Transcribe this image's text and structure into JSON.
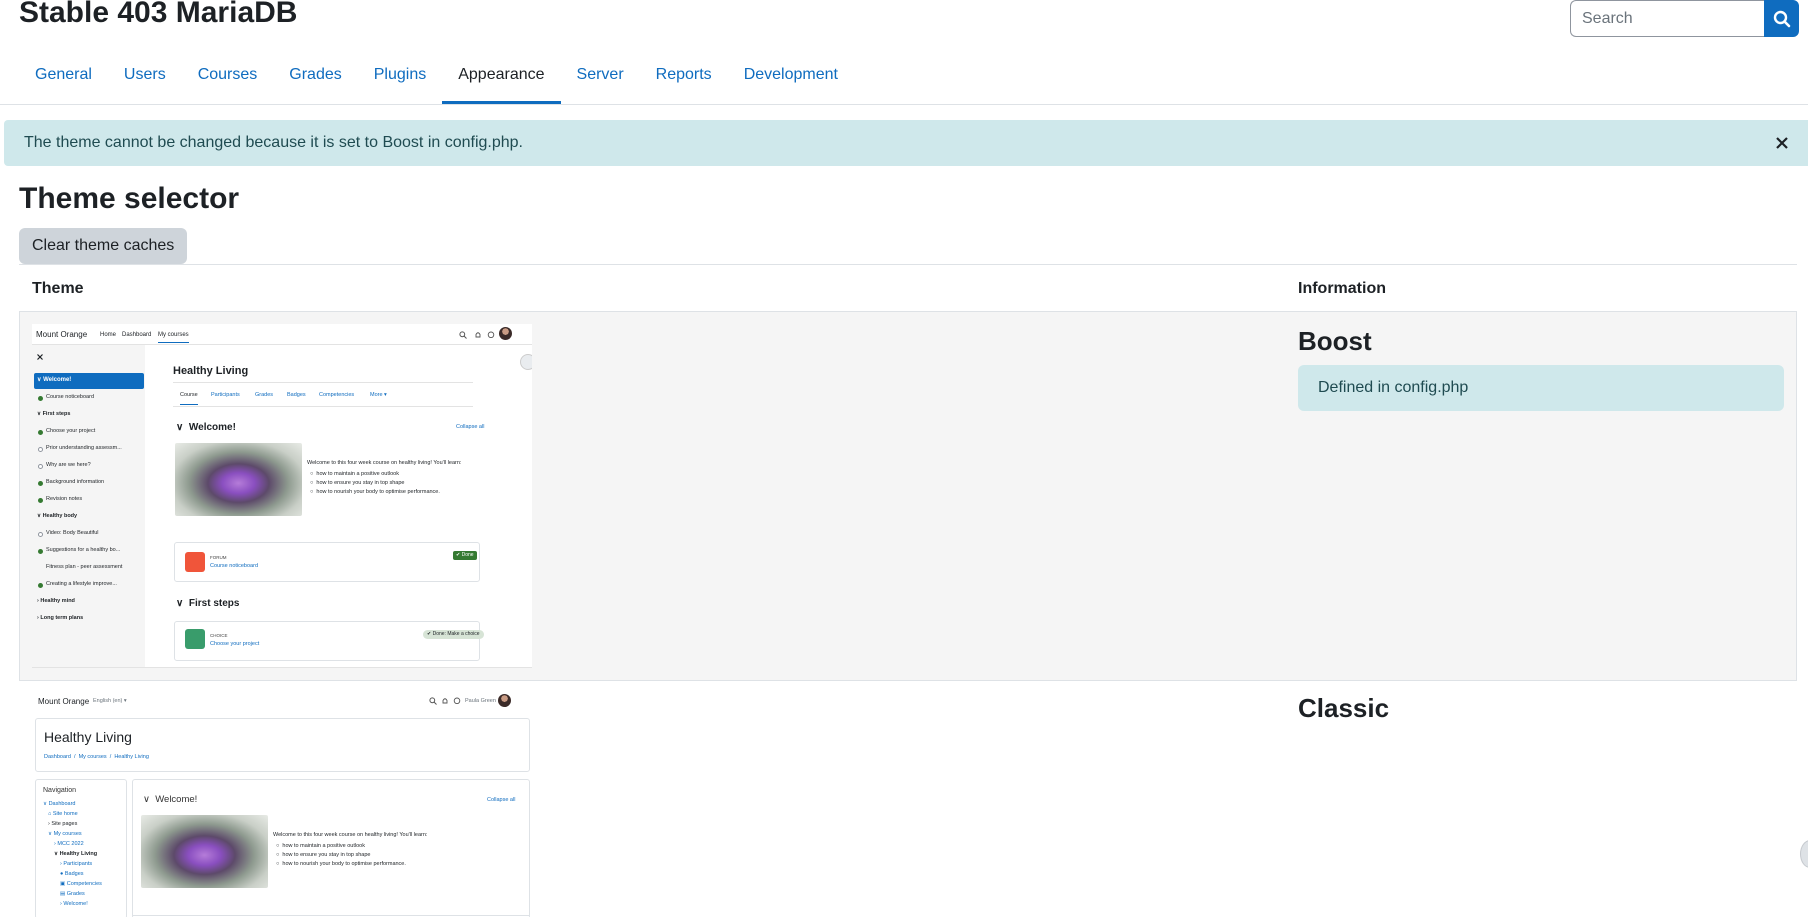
{
  "header": {
    "site_title": "Stable 403 MariaDB",
    "search_placeholder": "Search"
  },
  "tabs": [
    {
      "label": "General",
      "active": false
    },
    {
      "label": "Users",
      "active": false
    },
    {
      "label": "Courses",
      "active": false
    },
    {
      "label": "Grades",
      "active": false
    },
    {
      "label": "Plugins",
      "active": false
    },
    {
      "label": "Appearance",
      "active": true
    },
    {
      "label": "Server",
      "active": false
    },
    {
      "label": "Reports",
      "active": false
    },
    {
      "label": "Development",
      "active": false
    }
  ],
  "alert": {
    "message": "The theme cannot be changed because it is set to Boost in config.php."
  },
  "page": {
    "heading": "Theme selector",
    "clear_button": "Clear theme caches"
  },
  "table": {
    "col_theme": "Theme",
    "col_info": "Information",
    "rows": [
      {
        "name": "Boost",
        "defined": "Defined in config.php"
      },
      {
        "name": "Classic"
      }
    ]
  },
  "boost_preview": {
    "brand": "Mount Orange",
    "nav": [
      "Home",
      "Dashboard",
      "My courses"
    ],
    "drawer": [
      {
        "label": "Welcome!",
        "type": "section-active"
      },
      {
        "label": "Course noticeboard",
        "type": "done"
      },
      {
        "label": "First steps",
        "type": "section"
      },
      {
        "label": "Choose your project",
        "type": "done"
      },
      {
        "label": "Prior understanding assessm...",
        "type": "todo"
      },
      {
        "label": "Why are we here?",
        "type": "todo"
      },
      {
        "label": "Background information",
        "type": "done"
      },
      {
        "label": "Revision notes",
        "type": "done"
      },
      {
        "label": "Healthy body",
        "type": "section"
      },
      {
        "label": "Video: Body Beautiful",
        "type": "todo"
      },
      {
        "label": "Suggestions for a healthy bo...",
        "type": "done"
      },
      {
        "label": "Fitness plan - peer assessment",
        "type": "plain"
      },
      {
        "label": "Creating a lifestyle improve...",
        "type": "done"
      },
      {
        "label": "Healthy mind",
        "type": "section-collapsed"
      },
      {
        "label": "Long term plans",
        "type": "section-collapsed"
      }
    ],
    "course_title": "Healthy Living",
    "course_tabs": [
      "Course",
      "Participants",
      "Grades",
      "Badges",
      "Competencies",
      "More"
    ],
    "section_welcome": "Welcome!",
    "collapse_all": "Collapse all",
    "intro": "Welcome to this four week course on healthy living! You'll learn:",
    "bullets": [
      "how to maintain a positive outlook",
      "how to ensure you stay in top shape",
      "how to nourish your body to optimise performance."
    ],
    "forum_type": "FORUM",
    "forum_name": "Course noticeboard",
    "done_badge": "Done",
    "section_first": "First steps",
    "choice_type": "CHOICE",
    "choice_name": "Choose your project",
    "choice_badge": "Done: Make a choice"
  },
  "classic_preview": {
    "brand": "Mount Orange",
    "lang": "English (en)",
    "user": "Paula Green",
    "course_title": "Healthy Living",
    "breadcrumb": [
      "Dashboard",
      "My courses",
      "Healthy Living"
    ],
    "nav_title": "Navigation",
    "nav_items": [
      "Dashboard",
      "Site home",
      "Site pages",
      "My courses",
      "MCC 2022",
      "Healthy Living",
      "Participants",
      "Badges",
      "Competencies",
      "Grades",
      "Welcome!"
    ],
    "section_welcome": "Welcome!",
    "collapse_all": "Collapse all",
    "intro": "Welcome to this four week course on healthy living! You'll learn:",
    "bullets": [
      "how to maintain a positive outlook",
      "how to ensure you stay in top shape",
      "how to nourish your body to optimise performance."
    ]
  },
  "colors": {
    "brand": "#0f6cbf",
    "alert_bg": "#cfe8eb",
    "alert_text": "#1f4b51",
    "success": "#357a32",
    "forum": "#f0553a",
    "choice": "#399c6b"
  }
}
